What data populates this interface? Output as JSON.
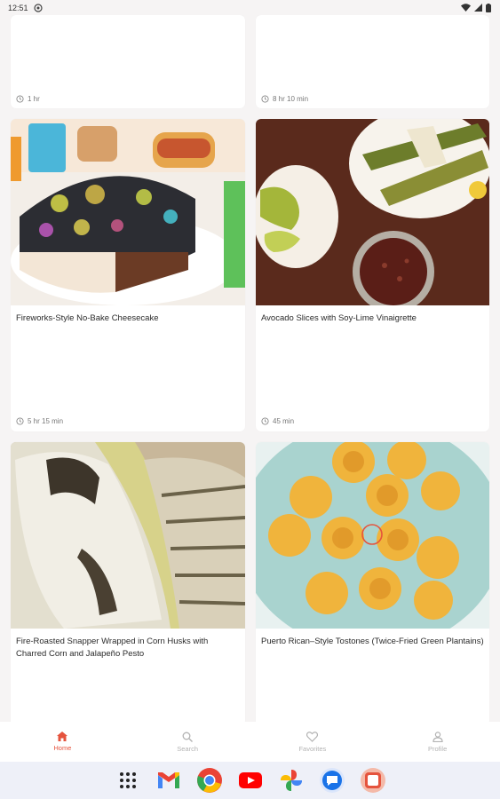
{
  "status_bar": {
    "time": "12:51"
  },
  "recipes": [
    {
      "title": "",
      "time": "1 hr"
    },
    {
      "title": "",
      "time": "8 hr 10 min"
    },
    {
      "title": "Fireworks-Style No-Bake Cheesecake",
      "time": "5 hr 15 min"
    },
    {
      "title": "Avocado Slices with Soy-Lime Vinaigrette",
      "time": "45 min"
    },
    {
      "title": "Fire-Roasted Snapper Wrapped in Corn Husks with Charred Corn and Jalapeño Pesto",
      "time": ""
    },
    {
      "title": "Puerto Rican–Style Tostones (Twice-Fried Green Plantains)",
      "time": ""
    }
  ],
  "bottom_nav": [
    {
      "label": "Home",
      "icon": "home-icon",
      "active": true
    },
    {
      "label": "Search",
      "icon": "search-icon",
      "active": false
    },
    {
      "label": "Favorites",
      "icon": "heart-icon",
      "active": false
    },
    {
      "label": "Profile",
      "icon": "person-icon",
      "active": false
    }
  ],
  "dock_apps": [
    "app-drawer-icon",
    "gmail-icon",
    "chrome-icon",
    "youtube-icon",
    "photos-icon",
    "messages-icon",
    "recipe-app-icon"
  ],
  "colors": {
    "accent": "#e5533d",
    "nav_inactive": "#b3b3b3",
    "background": "#f6f4f4"
  }
}
